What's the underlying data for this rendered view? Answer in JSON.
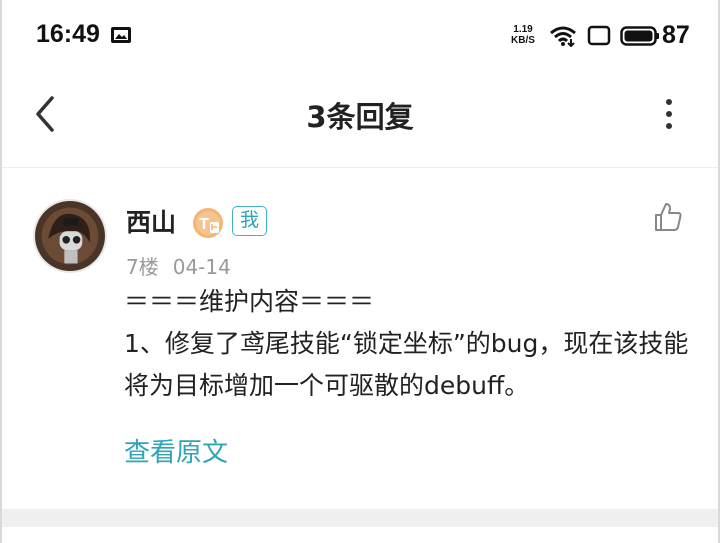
{
  "status_bar": {
    "time": "16:49",
    "net_speed_value": "1.19",
    "net_speed_unit": "KB/S",
    "battery": "87",
    "icons": [
      "notification-icon",
      "wifi-icon",
      "screen-icon",
      "battery-icon"
    ]
  },
  "header": {
    "title": "3条回复",
    "icons": [
      "back-arrow-icon",
      "more-vertical-icon"
    ]
  },
  "reply": {
    "username": "西山",
    "level_badge": "T",
    "me_badge": "我",
    "floor": "7楼",
    "date": "04-14",
    "content_line1": "＝＝＝维护内容＝＝＝",
    "content_line2": "1、修复了鸢尾技能“锁定坐标”的bug，现在该技能将为目标增加一个可驱散的debuff。",
    "view_original": "查看原文",
    "icons": [
      "avatar-image",
      "thumbs-up-icon"
    ],
    "link_color": "#2ea4b6"
  }
}
